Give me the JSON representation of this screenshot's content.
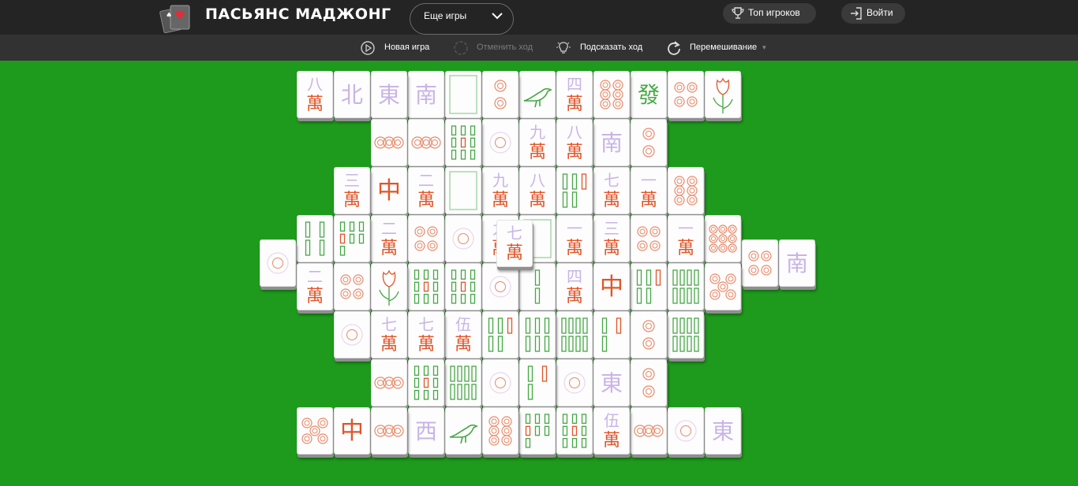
{
  "header": {
    "title": "ПАСЬЯНС МАДЖОНГ",
    "more_games_label": "Еще игры",
    "top_players_label": "Топ игроков",
    "login_label": "Войти"
  },
  "toolbar": {
    "new_game": "Новая игра",
    "undo": "Отменить ход",
    "hint": "Подсказать ход",
    "shuffle": "Перемешивание"
  },
  "colors": {
    "felt": "#1e9a1c",
    "topbar": "#242424",
    "toolbar": "#323232",
    "character_red": "#e0562a",
    "light_purple": "#c9b4e6",
    "bamboo_green": "#45a845",
    "circle_orange": "#e88a6a"
  },
  "board": {
    "tiles": [
      {
        "kind": "char",
        "glyph": "八",
        "col": 0,
        "row": 0,
        "layer": 0
      },
      {
        "kind": "wind",
        "glyph": "北",
        "col": 1,
        "row": 0,
        "layer": 0
      },
      {
        "kind": "wind",
        "glyph": "東",
        "col": 2,
        "row": 0,
        "layer": 0
      },
      {
        "kind": "wind",
        "glyph": "南",
        "col": 3,
        "row": 0,
        "layer": 0
      },
      {
        "kind": "white",
        "col": 4,
        "row": 0,
        "layer": 0
      },
      {
        "kind": "circle",
        "n": 2,
        "col": 5,
        "row": 0,
        "layer": 0
      },
      {
        "kind": "bird",
        "col": 6,
        "row": 0,
        "layer": 0
      },
      {
        "kind": "char",
        "glyph": "四",
        "col": 7,
        "row": 0,
        "layer": 0
      },
      {
        "kind": "circle",
        "n": 6,
        "col": 8,
        "row": 0,
        "layer": 0
      },
      {
        "kind": "green",
        "glyph": "發",
        "col": 9,
        "row": 0,
        "layer": 0
      },
      {
        "kind": "circle",
        "n": 4,
        "col": 10,
        "row": 0,
        "layer": 0
      },
      {
        "kind": "flower",
        "col": 11,
        "row": 0,
        "layer": 0
      },
      {
        "kind": "circle",
        "n": 3,
        "col": 2,
        "row": 1,
        "layer": 0
      },
      {
        "kind": "circle",
        "n": 3,
        "col": 3,
        "row": 1,
        "layer": 0
      },
      {
        "kind": "bamboo",
        "n": 9,
        "col": 4,
        "row": 1,
        "layer": 0
      },
      {
        "kind": "circle",
        "n": 1,
        "col": 5,
        "row": 1,
        "layer": 0
      },
      {
        "kind": "char",
        "glyph": "九",
        "col": 6,
        "row": 1,
        "layer": 0
      },
      {
        "kind": "char",
        "glyph": "八",
        "col": 7,
        "row": 1,
        "layer": 0
      },
      {
        "kind": "wind",
        "glyph": "南",
        "col": 8,
        "row": 1,
        "layer": 0
      },
      {
        "kind": "circle",
        "n": 2,
        "col": 9,
        "row": 1,
        "layer": 0
      },
      {
        "kind": "char",
        "glyph": "三",
        "col": 1,
        "row": 2,
        "layer": 0
      },
      {
        "kind": "red",
        "glyph": "中",
        "col": 2,
        "row": 2,
        "layer": 0
      },
      {
        "kind": "char",
        "glyph": "二",
        "col": 3,
        "row": 2,
        "layer": 0
      },
      {
        "kind": "white",
        "col": 4,
        "row": 2,
        "layer": 0
      },
      {
        "kind": "char",
        "glyph": "九",
        "col": 5,
        "row": 2,
        "layer": 0
      },
      {
        "kind": "char",
        "glyph": "八",
        "col": 6,
        "row": 2,
        "layer": 0
      },
      {
        "kind": "bamboo",
        "n": 5,
        "col": 7,
        "row": 2,
        "layer": 0
      },
      {
        "kind": "char",
        "glyph": "七",
        "col": 8,
        "row": 2,
        "layer": 0
      },
      {
        "kind": "char",
        "glyph": "一",
        "col": 9,
        "row": 2,
        "layer": 0
      },
      {
        "kind": "circle",
        "n": 6,
        "col": 10,
        "row": 2,
        "layer": 0
      },
      {
        "kind": "circle",
        "n": 1,
        "col": -1,
        "row": 3.5,
        "layer": 0
      },
      {
        "kind": "bamboo",
        "n": 4,
        "col": 0,
        "row": 3,
        "layer": 0
      },
      {
        "kind": "bamboo",
        "n": 7,
        "col": 1,
        "row": 3,
        "layer": 0
      },
      {
        "kind": "char",
        "glyph": "二",
        "col": 2,
        "row": 3,
        "layer": 0
      },
      {
        "kind": "circle",
        "n": 4,
        "col": 3,
        "row": 3,
        "layer": 0
      },
      {
        "kind": "circle",
        "n": 1,
        "col": 4,
        "row": 3,
        "layer": 0
      },
      {
        "kind": "char",
        "glyph": "九",
        "col": 5,
        "row": 3,
        "layer": 0
      },
      {
        "kind": "white",
        "col": 6,
        "row": 3,
        "layer": 0
      },
      {
        "kind": "char",
        "glyph": "一",
        "col": 7,
        "row": 3,
        "layer": 0
      },
      {
        "kind": "char",
        "glyph": "三",
        "col": 8,
        "row": 3,
        "layer": 0
      },
      {
        "kind": "circle",
        "n": 4,
        "col": 9,
        "row": 3,
        "layer": 0
      },
      {
        "kind": "char",
        "glyph": "一",
        "col": 10,
        "row": 3,
        "layer": 0
      },
      {
        "kind": "circle",
        "n": 9,
        "col": 11,
        "row": 3,
        "layer": 0
      },
      {
        "kind": "circle",
        "n": 4,
        "col": 12,
        "row": 3.5,
        "layer": 0
      },
      {
        "kind": "wind",
        "glyph": "南",
        "col": 13,
        "row": 3.5,
        "layer": 0
      },
      {
        "kind": "char",
        "glyph": "二",
        "col": 0,
        "row": 4,
        "layer": 0
      },
      {
        "kind": "circle",
        "n": 4,
        "col": 1,
        "row": 4,
        "layer": 0
      },
      {
        "kind": "flower",
        "col": 2,
        "row": 4,
        "layer": 0
      },
      {
        "kind": "bamboo",
        "n": 9,
        "col": 3,
        "row": 4,
        "layer": 0
      },
      {
        "kind": "bamboo",
        "n": 9,
        "col": 4,
        "row": 4,
        "layer": 0
      },
      {
        "kind": "circle",
        "n": 1,
        "col": 5,
        "row": 4,
        "layer": 0
      },
      {
        "kind": "bamboo",
        "n": 2,
        "col": 6,
        "row": 4,
        "layer": 0
      },
      {
        "kind": "char",
        "glyph": "四",
        "col": 7,
        "row": 4,
        "layer": 0
      },
      {
        "kind": "red",
        "glyph": "中",
        "col": 8,
        "row": 4,
        "layer": 0
      },
      {
        "kind": "bamboo",
        "n": 5,
        "col": 9,
        "row": 4,
        "layer": 0
      },
      {
        "kind": "bamboo",
        "n": 8,
        "col": 10,
        "row": 4,
        "layer": 0
      },
      {
        "kind": "circle",
        "n": 5,
        "col": 11,
        "row": 4,
        "layer": 0
      },
      {
        "kind": "circle",
        "n": 1,
        "col": 1,
        "row": 5,
        "layer": 0
      },
      {
        "kind": "char",
        "glyph": "七",
        "col": 2,
        "row": 5,
        "layer": 0
      },
      {
        "kind": "char",
        "glyph": "七",
        "col": 3,
        "row": 5,
        "layer": 0
      },
      {
        "kind": "char",
        "glyph": "伍",
        "col": 4,
        "row": 5,
        "layer": 0
      },
      {
        "kind": "bamboo",
        "n": 5,
        "col": 5,
        "row": 5,
        "layer": 0
      },
      {
        "kind": "bamboo",
        "n": 6,
        "col": 6,
        "row": 5,
        "layer": 0
      },
      {
        "kind": "bamboo",
        "n": 8,
        "col": 7,
        "row": 5,
        "layer": 0
      },
      {
        "kind": "bamboo",
        "n": 3,
        "col": 8,
        "row": 5,
        "layer": 0
      },
      {
        "kind": "circle",
        "n": 2,
        "col": 9,
        "row": 5,
        "layer": 0
      },
      {
        "kind": "bamboo",
        "n": 8,
        "col": 10,
        "row": 5,
        "layer": 0
      },
      {
        "kind": "circle",
        "n": 3,
        "col": 2,
        "row": 6,
        "layer": 0
      },
      {
        "kind": "bamboo",
        "n": 9,
        "col": 3,
        "row": 6,
        "layer": 0
      },
      {
        "kind": "bamboo",
        "n": 8,
        "col": 4,
        "row": 6,
        "layer": 0
      },
      {
        "kind": "circle",
        "n": 1,
        "col": 5,
        "row": 6,
        "layer": 0
      },
      {
        "kind": "bamboo",
        "n": 3,
        "col": 6,
        "row": 6,
        "layer": 0
      },
      {
        "kind": "circle",
        "n": 1,
        "col": 7,
        "row": 6,
        "layer": 0
      },
      {
        "kind": "wind",
        "glyph": "東",
        "col": 8,
        "row": 6,
        "layer": 0
      },
      {
        "kind": "circle",
        "n": 2,
        "col": 9,
        "row": 6,
        "layer": 0
      },
      {
        "kind": "circle",
        "n": 5,
        "col": 0,
        "row": 7,
        "layer": 0
      },
      {
        "kind": "red",
        "glyph": "中",
        "col": 1,
        "row": 7,
        "layer": 0
      },
      {
        "kind": "circle",
        "n": 3,
        "col": 2,
        "row": 7,
        "layer": 0
      },
      {
        "kind": "wind",
        "glyph": "西",
        "col": 3,
        "row": 7,
        "layer": 0
      },
      {
        "kind": "bird",
        "col": 4,
        "row": 7,
        "layer": 0
      },
      {
        "kind": "circle",
        "n": 6,
        "col": 5,
        "row": 7,
        "layer": 0
      },
      {
        "kind": "bamboo",
        "n": 7,
        "col": 6,
        "row": 7,
        "layer": 0
      },
      {
        "kind": "bamboo",
        "n": 9,
        "col": 7,
        "row": 7,
        "layer": 0
      },
      {
        "kind": "char",
        "glyph": "伍",
        "col": 8,
        "row": 7,
        "layer": 0
      },
      {
        "kind": "circle",
        "n": 3,
        "col": 9,
        "row": 7,
        "layer": 0
      },
      {
        "kind": "circle",
        "n": 1,
        "col": 10,
        "row": 7,
        "layer": 0
      },
      {
        "kind": "wind",
        "glyph": "東",
        "col": 11,
        "row": 7,
        "layer": 0
      },
      {
        "kind": "char",
        "glyph": "七",
        "col": 5.5,
        "row": 3.2,
        "layer": 1
      }
    ]
  }
}
